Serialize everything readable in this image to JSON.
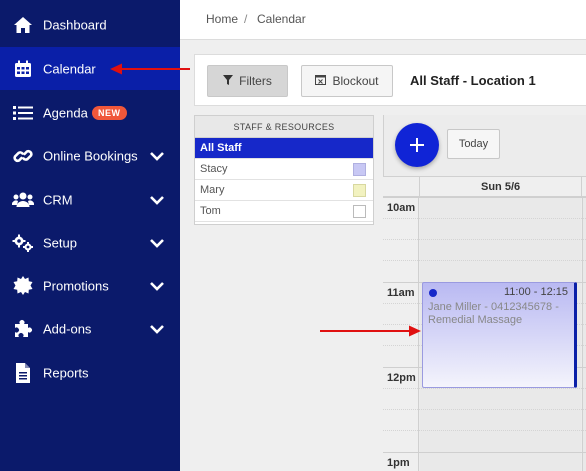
{
  "sidebar": {
    "items": [
      {
        "label": "Dashboard",
        "icon": "home-icon"
      },
      {
        "label": "Calendar",
        "icon": "calendar-icon",
        "active": true
      },
      {
        "label": "Agenda",
        "icon": "list-icon",
        "badge": "NEW"
      },
      {
        "label": "Online Bookings",
        "icon": "link-icon",
        "expandable": true
      },
      {
        "label": "CRM",
        "icon": "users-icon",
        "expandable": true
      },
      {
        "label": "Setup",
        "icon": "cogs-icon",
        "expandable": true
      },
      {
        "label": "Promotions",
        "icon": "certificate-icon",
        "expandable": true
      },
      {
        "label": "Add-ons",
        "icon": "puzzle-icon",
        "expandable": true
      },
      {
        "label": "Reports",
        "icon": "document-icon"
      }
    ]
  },
  "breadcrumb": {
    "home": "Home",
    "separator": "/",
    "current": "Calendar"
  },
  "toolbar": {
    "filters_label": "Filters",
    "blockout_label": "Blockout",
    "title": "All Staff - Location 1"
  },
  "staff_panel": {
    "header": "STAFF & RESOURCES",
    "items": [
      {
        "name": "All Staff",
        "selected": true
      },
      {
        "name": "Stacy",
        "color": "#c8c8f4"
      },
      {
        "name": "Mary",
        "color": "#f2f2c0"
      },
      {
        "name": "Tom",
        "color": "#ffffff"
      }
    ]
  },
  "calendar": {
    "add_label": "+",
    "today_label": "Today",
    "day_label": "Sun 5/6",
    "times": [
      "10am",
      "11am",
      "12pm",
      "1pm"
    ],
    "appointment": {
      "time": "11:00 - 12:15",
      "text": "Jane Miller - 0412345678 - Remedial Massage"
    }
  },
  "colors": {
    "sidebar_bg": "#0b1a6b",
    "sidebar_active": "#0a1fa8",
    "accent": "#1024d6",
    "badge": "#f0573a",
    "annotation_arrow": "#e01010"
  }
}
